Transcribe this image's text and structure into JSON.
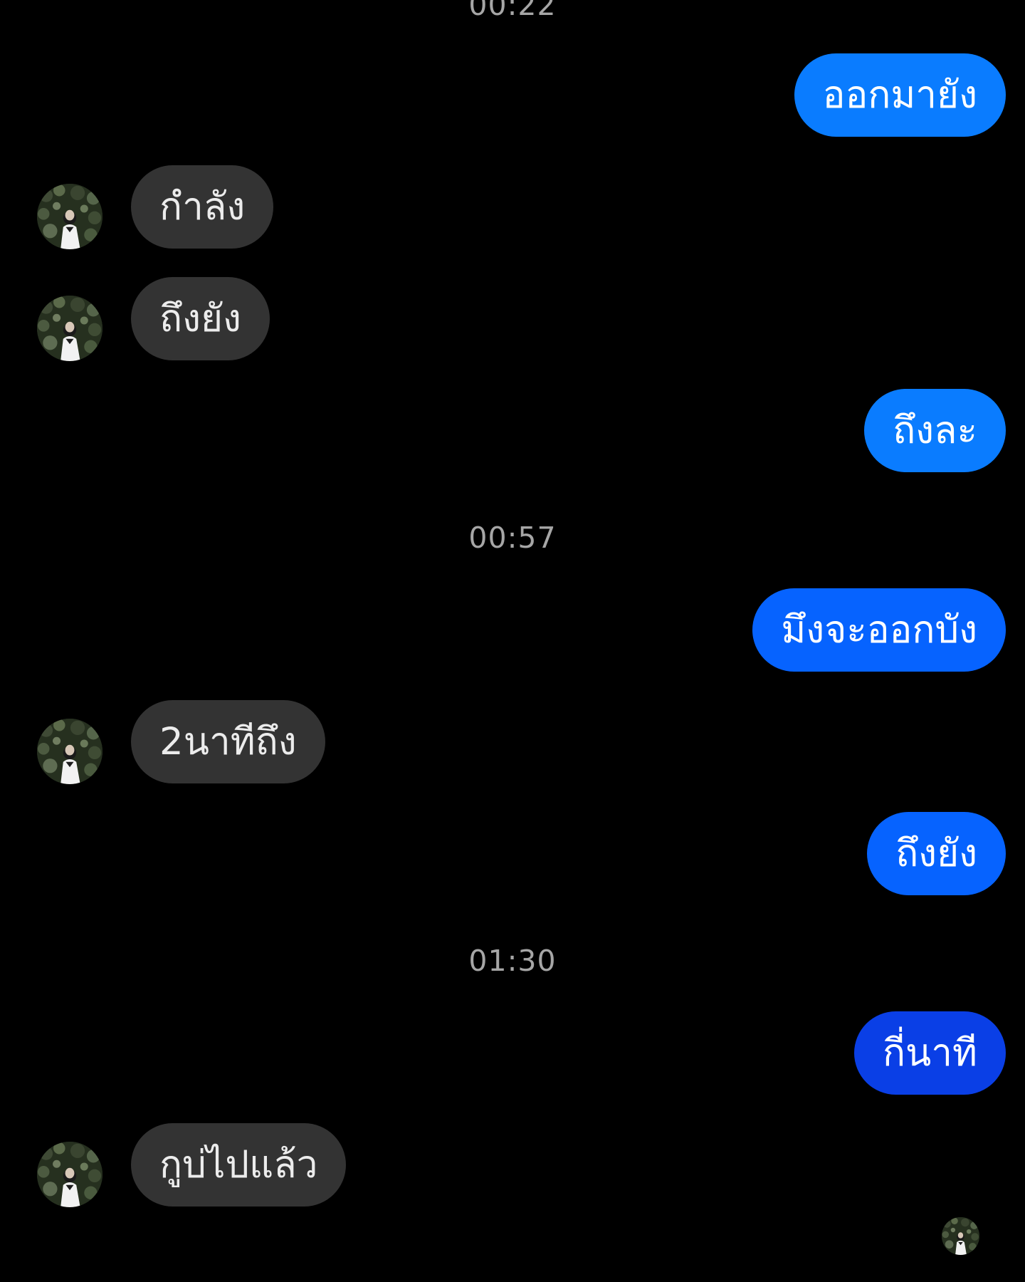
{
  "colors": {
    "background": "#000000",
    "sent_bubble_light": "#0a7cff",
    "sent_bubble_mid": "#0663ff",
    "sent_bubble_dark": "#0a3fe6",
    "received_bubble": "#333333",
    "timestamp_text": "#a6a6a6"
  },
  "timestamps": [
    "00:22",
    "00:57",
    "01:30"
  ],
  "messages": [
    {
      "direction": "sent",
      "text": "ออกมายัง",
      "color": "#0a7cff"
    },
    {
      "direction": "received",
      "text": "กำลัง",
      "avatar": "contact-avatar"
    },
    {
      "direction": "received",
      "text": "ถึงยัง",
      "avatar": "contact-avatar"
    },
    {
      "direction": "sent",
      "text": "ถึงละ",
      "color": "#0a7cff"
    },
    {
      "direction": "sent",
      "text": "มึงจะออกบัง",
      "color": "#0663ff"
    },
    {
      "direction": "received",
      "text": "2นาทีถึง",
      "avatar": "contact-avatar"
    },
    {
      "direction": "sent",
      "text": "ถึงยัง",
      "color": "#0663ff"
    },
    {
      "direction": "sent",
      "text": "กี่นาที",
      "color": "#0a3fe6"
    },
    {
      "direction": "received",
      "text": "กูบ่ไปแล้ว",
      "avatar": "contact-avatar"
    }
  ],
  "read_receipt": {
    "icon": "contact-avatar"
  }
}
